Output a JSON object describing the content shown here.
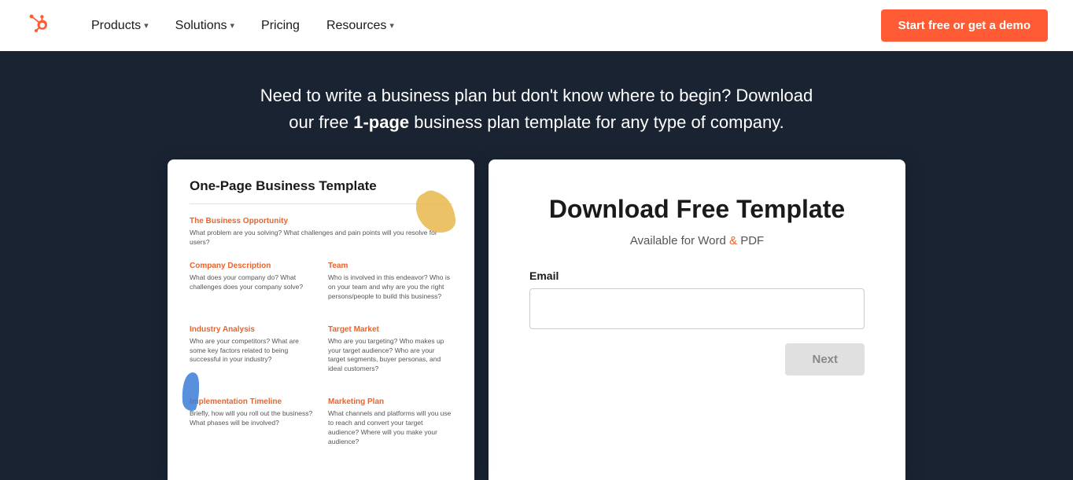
{
  "nav": {
    "logo_alt": "HubSpot",
    "items": [
      {
        "label": "Products",
        "has_dropdown": true
      },
      {
        "label": "Solutions",
        "has_dropdown": true
      },
      {
        "label": "Pricing",
        "has_dropdown": false
      },
      {
        "label": "Resources",
        "has_dropdown": true
      }
    ],
    "cta_label": "Start free or get a demo"
  },
  "hero": {
    "text_part1": "Need to write a business plan but don't know where to begin? Download our free ",
    "highlight": "1-page",
    "text_part2": " business plan template for any type of company."
  },
  "template_card": {
    "title": "One-Page Business Template",
    "sections": [
      {
        "id": "top",
        "heading": "The Business Opportunity",
        "text": "What problem are you solving? What challenges and pain points will you resolve for users?"
      }
    ],
    "grid_sections": [
      {
        "heading": "Company Description",
        "text": "What does your company do? What challenges does your company solve?"
      },
      {
        "heading": "Team",
        "text": "Who is involved in this endeavor? Who is on your team and why are you the right persons/people to build this business?"
      },
      {
        "heading": "Industry Analysis",
        "text": "Who are your competitors? What are some key factors related to being successful in your industry?"
      },
      {
        "heading": "Target Market",
        "text": "Who are you targeting? Who makes up your target audience? Who are your target segments, buyer personas, and ideal customers?"
      },
      {
        "heading": "Implementation Timeline",
        "text": "Briefly, how will you roll out the business? What phases will be involved?"
      },
      {
        "heading": "Marketing Plan",
        "text": "What channels and platforms will you use to reach and convert your target audience? Where will you make your audience?"
      }
    ]
  },
  "form_card": {
    "headline": "Download Free Template",
    "subtext_before": "Available for Word ",
    "subtext_amp": "& ",
    "subtext_after": "PDF",
    "email_label": "Email",
    "email_placeholder": "",
    "next_button": "Next"
  }
}
